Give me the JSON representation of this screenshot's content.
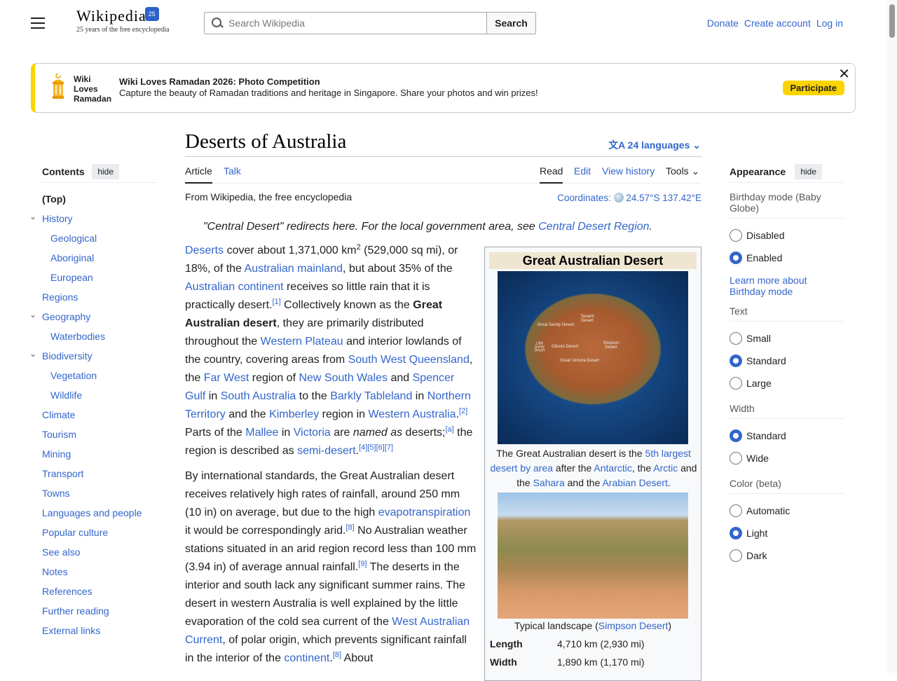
{
  "header": {
    "logo_text": "Wikipedia",
    "logo_badge": "25",
    "tagline": "25 years of the free encyclopedia",
    "search_placeholder": "Search Wikipedia",
    "search_button": "Search",
    "links": [
      "Donate",
      "Create account",
      "Log in"
    ]
  },
  "banner": {
    "logo_lines": [
      "Wiki",
      "Loves",
      "Ramadan"
    ],
    "title": "Wiki Loves Ramadan 2026: Photo Competition",
    "text": "Capture the beauty of Ramadan traditions and heritage in Singapore. Share your photos and win prizes!",
    "button": "Participate",
    "close": "✕"
  },
  "toc": {
    "title": "Contents",
    "hide": "hide",
    "items": [
      {
        "label": "(Top)",
        "level": 0,
        "top": true
      },
      {
        "label": "History",
        "level": 0,
        "expand": true
      },
      {
        "label": "Geological",
        "level": 1
      },
      {
        "label": "Aboriginal",
        "level": 1
      },
      {
        "label": "European",
        "level": 1
      },
      {
        "label": "Regions",
        "level": 0
      },
      {
        "label": "Geography",
        "level": 0,
        "expand": true
      },
      {
        "label": "Waterbodies",
        "level": 1
      },
      {
        "label": "Biodiversity",
        "level": 0,
        "expand": true
      },
      {
        "label": "Vegetation",
        "level": 1
      },
      {
        "label": "Wildlife",
        "level": 1
      },
      {
        "label": "Climate",
        "level": 0
      },
      {
        "label": "Tourism",
        "level": 0
      },
      {
        "label": "Mining",
        "level": 0
      },
      {
        "label": "Transport",
        "level": 0
      },
      {
        "label": "Towns",
        "level": 0
      },
      {
        "label": "Languages and people",
        "level": 0
      },
      {
        "label": "Popular culture",
        "level": 0
      },
      {
        "label": "See also",
        "level": 0
      },
      {
        "label": "Notes",
        "level": 0
      },
      {
        "label": "References",
        "level": 0
      },
      {
        "label": "Further reading",
        "level": 0
      },
      {
        "label": "External links",
        "level": 0
      }
    ]
  },
  "article": {
    "title": "Deserts of Australia",
    "languages": "24 languages",
    "tabs": {
      "article": "Article",
      "talk": "Talk",
      "read": "Read",
      "edit": "Edit",
      "history": "View history",
      "tools": "Tools"
    },
    "from": "From Wikipedia, the free encyclopedia",
    "coords_label": "Coordinates:",
    "coords": "24.57°S 137.42°E",
    "hatnote": [
      {
        "t": "\"Central Desert\" redirects here. For the local government area, see "
      },
      {
        "t": "Central Desert Region",
        "l": 1
      },
      {
        "t": "."
      }
    ],
    "paragraphs": [
      [
        {
          "t": "Deserts",
          "l": 1
        },
        {
          "t": " cover about 1,371,000 km"
        },
        {
          "t": "2",
          "s": 1
        },
        {
          "t": " (529,000 sq mi), or 18%, of the "
        },
        {
          "t": "Australian mainland",
          "l": 1
        },
        {
          "t": ", but about 35% of the "
        },
        {
          "t": "Australian continent",
          "l": 1
        },
        {
          "t": " receives so little rain that it is practically desert."
        },
        {
          "t": "[1]",
          "s": 1,
          "l": 1
        },
        {
          "t": " Collectively known as the "
        },
        {
          "t": "Great Australian desert",
          "b": 1
        },
        {
          "t": ", they are primarily distributed throughout the "
        },
        {
          "t": "Western Plateau",
          "l": 1
        },
        {
          "t": " and interior lowlands of the country, covering areas from "
        },
        {
          "t": "South West Queensland",
          "l": 1
        },
        {
          "t": ", the "
        },
        {
          "t": "Far West",
          "l": 1
        },
        {
          "t": " region of "
        },
        {
          "t": "New South Wales",
          "l": 1
        },
        {
          "t": " and "
        },
        {
          "t": "Spencer Gulf",
          "l": 1
        },
        {
          "t": " in "
        },
        {
          "t": "South Australia",
          "l": 1
        },
        {
          "t": " to the "
        },
        {
          "t": "Barkly Tableland",
          "l": 1
        },
        {
          "t": " in "
        },
        {
          "t": "Northern Territory",
          "l": 1
        },
        {
          "t": " and the "
        },
        {
          "t": "Kimberley",
          "l": 1
        },
        {
          "t": " region in "
        },
        {
          "t": "Western Australia",
          "l": 1
        },
        {
          "t": ".",
          "l": 0
        },
        {
          "t": "[2]",
          "s": 1,
          "l": 1
        },
        {
          "t": " Parts of the "
        },
        {
          "t": "Mallee",
          "l": 1
        },
        {
          "t": " in "
        },
        {
          "t": "Victoria",
          "l": 1
        },
        {
          "t": " are "
        },
        {
          "t": "named as",
          "i": 1
        },
        {
          "t": " deserts;"
        },
        {
          "t": "[a]",
          "s": 1,
          "l": 1
        },
        {
          "t": " the region is described as "
        },
        {
          "t": "semi-desert",
          "l": 1
        },
        {
          "t": "."
        },
        {
          "t": "[4][5][6][7]",
          "s": 1,
          "l": 1
        }
      ],
      [
        {
          "t": "By international standards, the Great Australian desert receives relatively high rates of rainfall, around 250 mm (10 in) on average, but due to the high "
        },
        {
          "t": "evapotranspiration",
          "l": 1
        },
        {
          "t": " it would be correspondingly arid."
        },
        {
          "t": "[8]",
          "s": 1,
          "l": 1
        },
        {
          "t": " No Australian weather stations situated in an arid region record less than 100 mm (3.94 in) of average annual rainfall."
        },
        {
          "t": "[9]",
          "s": 1,
          "l": 1
        },
        {
          "t": " The deserts in the interior and south lack any significant summer rains. The desert in western Australia is well explained by the little evaporation of the cold sea current of the "
        },
        {
          "t": "West Australian Current",
          "l": 1
        },
        {
          "t": ", of polar origin, which prevents significant rainfall in the interior of the "
        },
        {
          "t": "continent",
          "l": 1
        },
        {
          "t": "."
        },
        {
          "t": "[8]",
          "s": 1,
          "l": 1
        },
        {
          "t": " About"
        }
      ]
    ]
  },
  "infobox": {
    "title": "Great Australian Desert",
    "map_labels": [
      "Tanami Desert",
      "Great Sandy Desert",
      "Little Sandy Desert",
      "Gibson Desert",
      "Simpson Desert",
      "Great Victoria Desert"
    ],
    "caption1": [
      {
        "t": "The Great Australian desert is the "
      },
      {
        "t": "5th largest desert by area",
        "l": 1
      },
      {
        "t": " after the "
      },
      {
        "t": "Antarctic",
        "l": 1
      },
      {
        "t": ", the "
      },
      {
        "t": "Arctic",
        "l": 1
      },
      {
        "t": " and the "
      },
      {
        "t": "Sahara",
        "l": 1
      },
      {
        "t": " and the "
      },
      {
        "t": "Arabian Desert",
        "l": 1
      },
      {
        "t": "."
      }
    ],
    "caption2": [
      {
        "t": "Typical landscape ("
      },
      {
        "t": "Simpson Desert",
        "l": 1
      },
      {
        "t": ")"
      }
    ],
    "rows": [
      {
        "label": "Length",
        "value": "4,710 km (2,930 mi)"
      },
      {
        "label": "Width",
        "value": "1,890 km (1,170 mi)"
      }
    ]
  },
  "appearance": {
    "title": "Appearance",
    "hide": "hide",
    "groups": [
      {
        "label": "Birthday mode (Baby Globe)",
        "options": [
          {
            "label": "Disabled",
            "on": false
          },
          {
            "label": "Enabled",
            "on": true
          }
        ],
        "link": "Learn more about Birthday mode"
      },
      {
        "label": "Text",
        "options": [
          {
            "label": "Small",
            "on": false
          },
          {
            "label": "Standard",
            "on": true
          },
          {
            "label": "Large",
            "on": false
          }
        ]
      },
      {
        "label": "Width",
        "options": [
          {
            "label": "Standard",
            "on": true
          },
          {
            "label": "Wide",
            "on": false
          }
        ]
      },
      {
        "label": "Color (beta)",
        "options": [
          {
            "label": "Automatic",
            "on": false
          },
          {
            "label": "Light",
            "on": true
          },
          {
            "label": "Dark",
            "on": false
          }
        ]
      }
    ]
  },
  "colors": {
    "link": "#3366cc",
    "banner_accent": "#fcd400",
    "radio_on": "#3366cc"
  }
}
